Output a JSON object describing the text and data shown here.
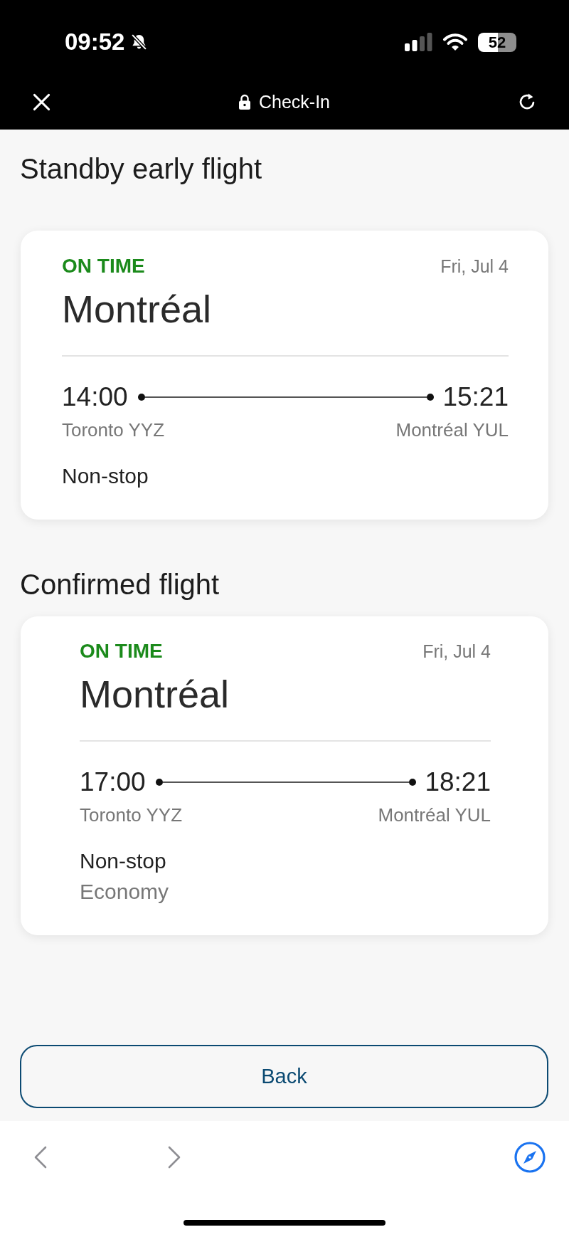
{
  "status_bar": {
    "time": "09:52",
    "battery": "52"
  },
  "browser_bar": {
    "title": "Check-In"
  },
  "sections": [
    {
      "heading": "Standby early flight",
      "flight": {
        "status": {
          "text": "ON TIME",
          "kind": "on_time"
        },
        "date": "Fri, Jul 4",
        "destination": "Montréal",
        "departure_time": "14:00",
        "arrival_time": "15:21",
        "origin_airport": "Toronto YYZ",
        "destination_airport": "Montréal YUL",
        "stops": "Non-stop"
      }
    },
    {
      "heading": "Confirmed flight",
      "flight": {
        "status": {
          "text": "ON TIME",
          "kind": "on_time"
        },
        "date": "Fri, Jul 4",
        "destination": "Montréal",
        "departure_time": "17:00",
        "arrival_time": "18:21",
        "origin_airport": "Toronto YYZ",
        "destination_airport": "Montréal YUL",
        "stops": "Non-stop",
        "cabin": "Economy"
      }
    }
  ],
  "back_button": "Back",
  "toolbar": {
    "buttons": [
      {
        "kind": "back",
        "disabled": true
      },
      {
        "kind": "forward",
        "disabled": true
      },
      {
        "kind": "compass",
        "disabled": false
      }
    ]
  }
}
